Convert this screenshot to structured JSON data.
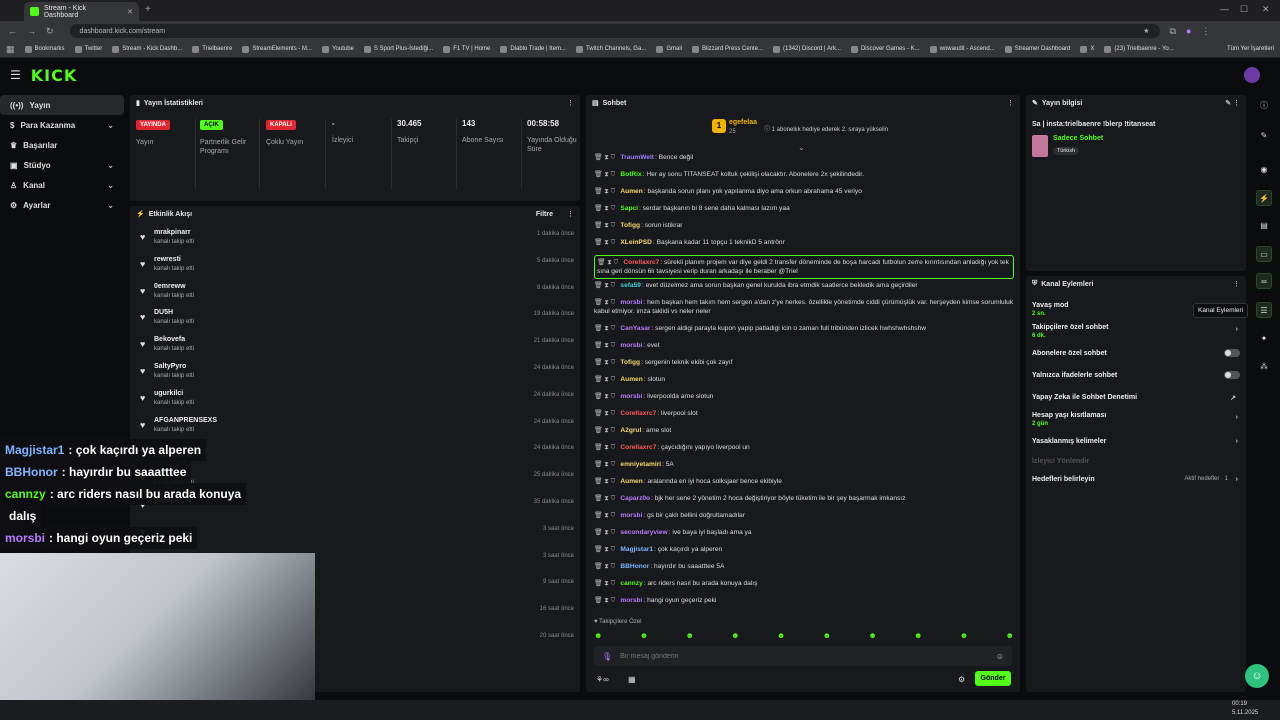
{
  "browser": {
    "tab_title": "Stream - Kick Dashboard",
    "url": "dashboard.kick.com/stream",
    "bookmarks": [
      "Bookmarks",
      "Twitter",
      "Stream - Kick Dashb...",
      "Trielbaenre",
      "StreamElements - M...",
      "Youtube",
      "S Sport Plus-İstediği...",
      "F1 TV | Home",
      "Diablo Trade | Item...",
      "Twitch Channels, Ga...",
      "Gmail",
      "Blizzard Press Cente...",
      "(1342) Discord | Ark...",
      "Discover Games - K...",
      "wowaudit - Ascend...",
      "Streamer Dashboard",
      "X",
      "(23) Trielbaenre - Yo..."
    ],
    "all_bookmarks": "Tüm Yer İşaretleri"
  },
  "brand": {
    "logo": "KICK",
    "accent": "#53fc18"
  },
  "sidebar": {
    "items": [
      {
        "label": "Yayın",
        "icon": "broadcast-icon"
      },
      {
        "label": "Para Kazanma",
        "icon": "dollar-icon"
      },
      {
        "label": "Başarılar",
        "icon": "trophy-icon"
      },
      {
        "label": "Stüdyo",
        "icon": "studio-icon"
      },
      {
        "label": "Kanal",
        "icon": "person-icon"
      },
      {
        "label": "Ayarlar",
        "icon": "gear-icon"
      }
    ]
  },
  "stats": {
    "title": "Yayın İstatistikleri",
    "cards": [
      {
        "badge": "YAYINDA",
        "label": "Yayın"
      },
      {
        "badge": "AÇIK",
        "label": "Partnerlik Gelir Programı"
      },
      {
        "badge": "KAPALI",
        "label": "Çoklu Yayın"
      },
      {
        "value": "-",
        "label": "İzleyici"
      },
      {
        "value": "30.465",
        "label": "Takipçi"
      },
      {
        "value": "143",
        "label": "Abone Sayısı"
      },
      {
        "value": "00:58:58",
        "label": "Yayında Olduğu Süre"
      }
    ]
  },
  "activity": {
    "title": "Etkinlik Akışı",
    "filter": "Filtre",
    "items": [
      {
        "name": "mrakpinarr",
        "sub": "kanalı takip etti",
        "time": "1 dakika önce"
      },
      {
        "name": "rewresti",
        "sub": "kanalı takip etti",
        "time": "5 dakika önce"
      },
      {
        "name": "0emreww",
        "sub": "kanalı takip etti",
        "time": "8 dakika önce"
      },
      {
        "name": "DU5H",
        "sub": "kanalı takip etti",
        "time": "19 dakika önce"
      },
      {
        "name": "Bekovefa",
        "sub": "kanalı takip etti",
        "time": "21 dakika önce"
      },
      {
        "name": "SaltyPyro",
        "sub": "kanalı takip etti",
        "time": "24 dakika önce"
      },
      {
        "name": "ugurkilci",
        "sub": "kanalı takip etti",
        "time": "24 dakika önce"
      },
      {
        "name": "AFGANPRENSEXS",
        "sub": "kanalı takip etti",
        "time": "24 dakika önce"
      },
      {
        "name": "",
        "sub": "kanalı takip etti",
        "time": "24 dakika önce"
      },
      {
        "name": "",
        "sub": "kanalı takip etti",
        "time": "25 dakika önce"
      },
      {
        "name": "yupopa",
        "sub": "",
        "time": "35 dakika önce"
      },
      {
        "name": "",
        "sub": "",
        "time": "3 saat önce"
      },
      {
        "name": "",
        "sub": "",
        "time": "3 saat önce"
      },
      {
        "name": "",
        "sub": "",
        "time": "9 saat önce"
      },
      {
        "name": "",
        "sub": "",
        "time": "16 saat önce"
      },
      {
        "name": "",
        "sub": "",
        "time": "20 saat önce"
      }
    ]
  },
  "chat": {
    "title": "Sohbet",
    "pinned_user": "egefelaa",
    "pinned_count": "25",
    "pinned_text": "1 aboneliık hediye ederek 2. sıraya yükselin",
    "messages": [
      {
        "user": "TraumWelt",
        "color": "#9b7bff",
        "text": "Bence değil"
      },
      {
        "user": "BotRix",
        "color": "#53fc18",
        "text": "Her ay sonu TITANSEAT koltuk çekilişi olacaktır. Abonelere 2x şekilindedir."
      },
      {
        "user": "Aumen",
        "color": "#f5d76e",
        "text": "başkanda sorun planı yok yapılanma diyo ama orkun abrahama 45 veriyo"
      },
      {
        "user": "Sapci",
        "color": "#53fc18",
        "text": "serdar başkanın bi 8 sene daha kalması lazım yaa"
      },
      {
        "user": "Tofigg",
        "color": "#f5d76e",
        "text": "sorun istikrar"
      },
      {
        "user": "XLeinPSD",
        "color": "#f5d76e",
        "text": "Başkana kadar 11 topçu 1 teknikD 5 antrönr"
      },
      {
        "user": "Corellaxrc7",
        "color": "#ff5b5b",
        "text": "sürekli planım projem var diye geldi 2 transfer döneminde de boşa harcadı futbolun zerre kırıntısından anladığı yok tek sına geri dönsün 6lı tavsiyesi verip duran arkadaşı ile beraber @Triel"
      },
      {
        "user": "sefa59",
        "color": "#3fd0e0",
        "text": "evet düzelmez ama sorun başkan genel kurulda ibra etmdik saatlerce bekledik ama geçirdiler"
      },
      {
        "user": "morsbi",
        "color": "#b77cff",
        "text": "hem başkan hem takım hem sergen a'dan z'ye herkes. özellikle yönetimde ciddi çürümüşlük var. herşeyden kimse sorumluluk kabul etmiyor. imza taklidi vs neler neler"
      },
      {
        "user": "CanYasar",
        "color": "#b77cff",
        "text": "sergen aldigi parayla kupon yapip patladigi icin o zaman full tribünden izlicek hwhshwhshshw"
      },
      {
        "user": "morsbi",
        "color": "#b77cff",
        "text": "evet"
      },
      {
        "user": "Tofigg",
        "color": "#f5d76e",
        "text": "sergenin teknik ekibi çok zayıf"
      },
      {
        "user": "Aumen",
        "color": "#f5d76e",
        "text": "slotun"
      },
      {
        "user": "morsbi",
        "color": "#b77cff",
        "text": "liverpoolda arne slotun"
      },
      {
        "user": "Corellaxrc7",
        "color": "#ff5b5b",
        "text": "liverpool slot"
      },
      {
        "user": "A2grul",
        "color": "#f5d76e",
        "text": "arne slot"
      },
      {
        "user": "Corellaxrc7",
        "color": "#ff5b5b",
        "text": "çaycıdığını yapıyo liverpool un"
      },
      {
        "user": "emniyetamiri",
        "color": "#f5d76e",
        "text": "5A"
      },
      {
        "user": "Aumen",
        "color": "#f5d76e",
        "text": "aralarında en iyi hoca solksjaer bence ekibiyle"
      },
      {
        "user": "Caparz0o",
        "color": "#b77cff",
        "text": "bjk her sene 2 yönetim 2 hoca değiştiriyor böyle tüketim ile bir şey başarmak imkansız"
      },
      {
        "user": "morsbi",
        "color": "#b77cff",
        "text": "gs bir çaklı bellini doğrultamadılar"
      },
      {
        "user": "secondaryview",
        "color": "#b77cff",
        "text": "ive baya iyi başladı ama ya"
      },
      {
        "user": "Magjistar1",
        "color": "#7fb4ff",
        "text": "çok kaçırdı ya alperen"
      },
      {
        "user": "BBHonor",
        "color": "#7fb4ff",
        "text": "hayırdır bu saaatttee 5A"
      },
      {
        "user": "cannzy",
        "color": "#53fc18",
        "text": "arc riders nasıl bu arada konuya dalış"
      },
      {
        "user": "morsbi",
        "color": "#b77cff",
        "text": "hangi oyun geçeriz peki"
      }
    ],
    "followers_only": "Takipçilere Özel",
    "input_placeholder": "Bir mesaj gönderin",
    "send": "Gönder"
  },
  "stream_info": {
    "title": "Yayın bilgisi",
    "stream_title": "Sa | insta:trielbaenre !blerp !titanseat",
    "category": "Sadece Sohbet",
    "language": "Türkish"
  },
  "channel_actions": {
    "title": "Kanal Eylemleri",
    "tooltip": "Kanal Eylemleri",
    "items": [
      {
        "label": "Yavaş mod",
        "sub": "2 sn."
      },
      {
        "label": "Takipçilere özel sohbet",
        "sub": "6 dk."
      },
      {
        "label": "Abonelere özel sohbet",
        "sub": ""
      },
      {
        "label": "Yalnızca ifadelerle sohbet",
        "sub": ""
      },
      {
        "label": "Yapay Zeka ile Sohbet Denetimi",
        "sub": ""
      },
      {
        "label": "Hesap yaşı kısıtlaması",
        "sub": "2 gün"
      },
      {
        "label": "Yasaklanmış kelimeler",
        "sub": ""
      },
      {
        "label": "İzleyici Yönlendir",
        "sub": ""
      },
      {
        "label": "Hedefleri belirleyin",
        "sub": ""
      }
    ],
    "goals_status": "Aktif hedefler · 1"
  },
  "overlay": {
    "lines": [
      {
        "user": "Magjistar1",
        "color": "#7fb4ff",
        "text": ": çok kaçırdı ya alperen"
      },
      {
        "user": "BBHonor",
        "color": "#7fb4ff",
        "text": ": hayırdır bu saaatttee"
      },
      {
        "user": "cannzy",
        "color": "#53fc18",
        "text": ": arc riders nasıl bu arada konuya"
      },
      {
        "user": "",
        "color": "#ffffff",
        "text": "dalış"
      },
      {
        "user": "morsbi",
        "color": "#b77cff",
        "text": ": hangi oyun geçeriz peki"
      }
    ]
  },
  "taskbar": {
    "time": "00:19",
    "date": "5.11.2025"
  }
}
